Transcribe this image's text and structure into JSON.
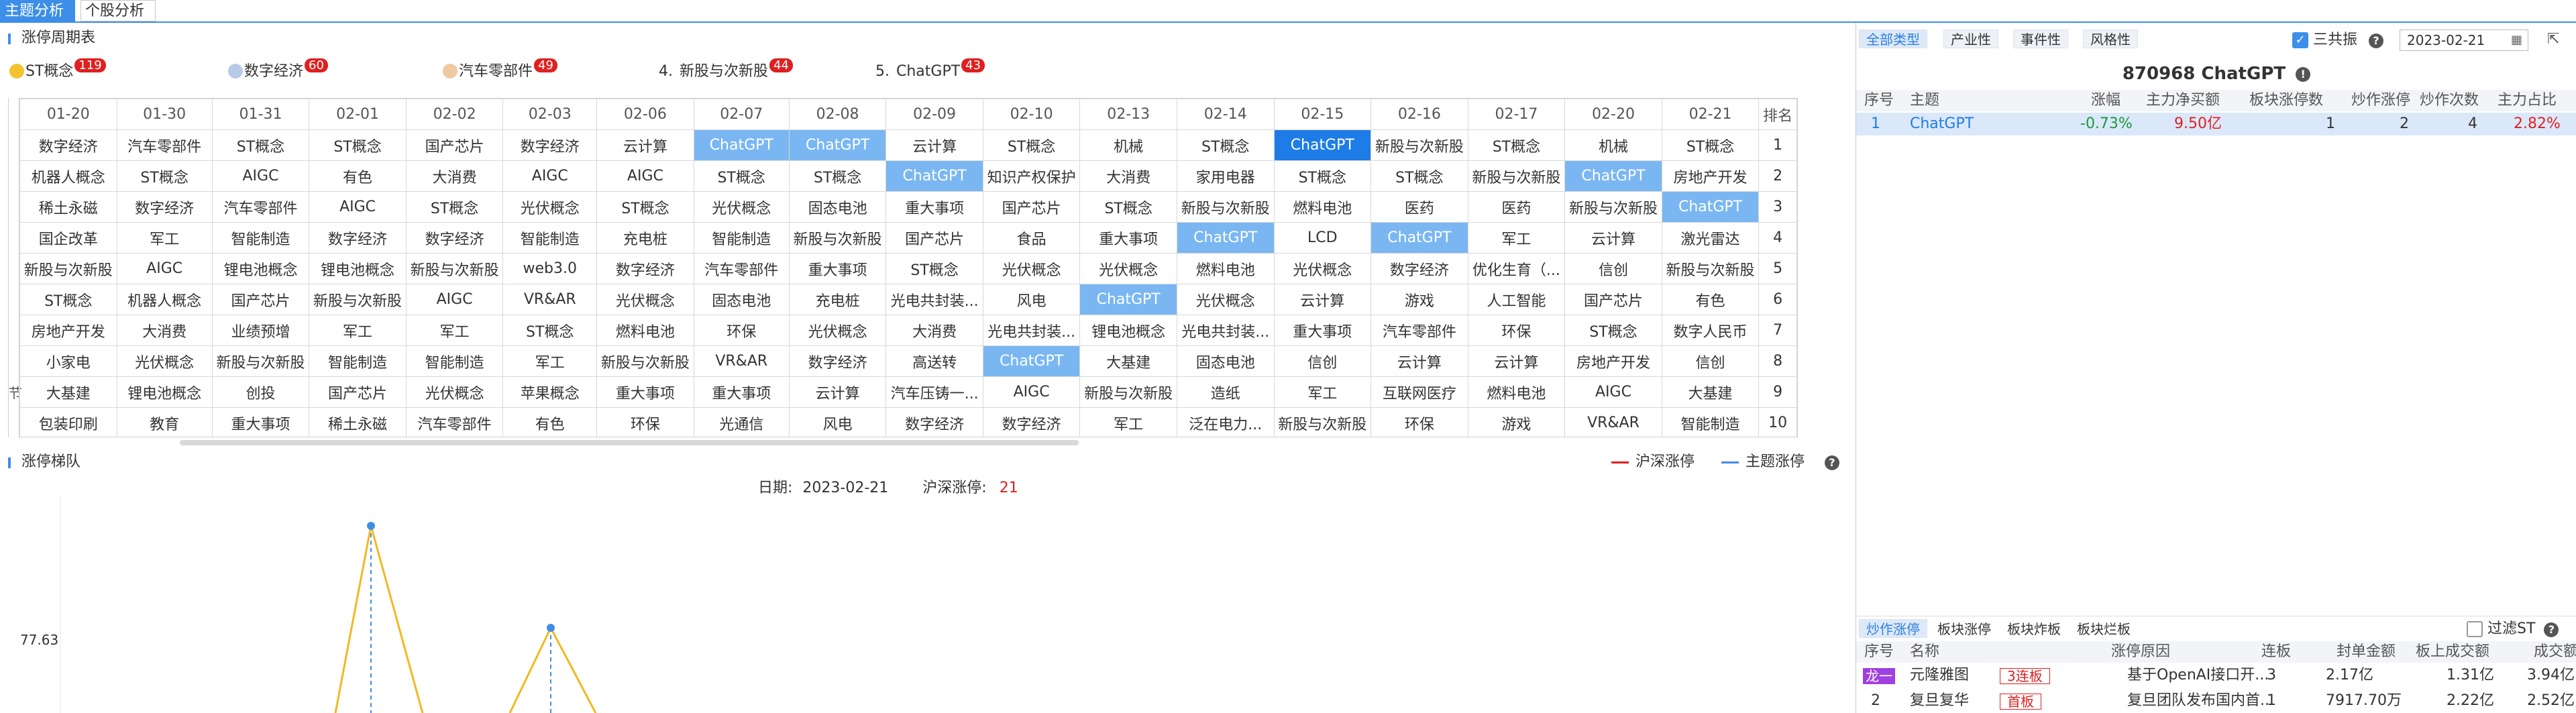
{
  "top_tabs": [
    "主题分析",
    "个股分析"
  ],
  "cycle_panel": {
    "title": "涨停周期表"
  },
  "leaders": [
    {
      "rank": "",
      "name": "ST概念",
      "count": "119",
      "dot": "#f2c230"
    },
    {
      "rank": "",
      "name": "数字经济",
      "count": "60",
      "dot": "#b9c9e8"
    },
    {
      "rank": "",
      "name": "汽车零部件",
      "count": "49",
      "dot": "#f0c8a0"
    },
    {
      "rank": "4.",
      "name": "新股与次新股",
      "count": "44",
      "dot": ""
    },
    {
      "rank": "5.",
      "name": "ChatGPT",
      "count": "43",
      "dot": ""
    }
  ],
  "cycle_table": {
    "dates": [
      "01-20",
      "01-30",
      "01-31",
      "02-01",
      "02-02",
      "02-03",
      "02-06",
      "02-07",
      "02-08",
      "02-09",
      "02-10",
      "02-13",
      "02-14",
      "02-15",
      "02-16",
      "02-17",
      "02-20",
      "02-21"
    ],
    "rank_header": "排名",
    "rows": [
      {
        "rank": "1",
        "cells": [
          "数字经济",
          "汽车零部件",
          "ST概念",
          "ST概念",
          "国产芯片",
          "数字经济",
          "云计算",
          "ChatGPT",
          "ChatGPT",
          "云计算",
          "ST概念",
          "机械",
          "ST概念",
          "ChatGPT",
          "新股与次新股",
          "ST概念",
          "机械",
          "ST概念"
        ]
      },
      {
        "rank": "2",
        "cells": [
          "机器人概念",
          "ST概念",
          "AIGC",
          "有色",
          "大消费",
          "AIGC",
          "AIGC",
          "ST概念",
          "ST概念",
          "ChatGPT",
          "知识产权保护",
          "大消费",
          "家用电器",
          "ST概念",
          "ST概念",
          "新股与次新股",
          "ChatGPT",
          "房地产开发"
        ]
      },
      {
        "rank": "3",
        "cells": [
          "稀土永磁",
          "数字经济",
          "汽车零部件",
          "AIGC",
          "ST概念",
          "光伏概念",
          "ST概念",
          "光伏概念",
          "固态电池",
          "重大事项",
          "国产芯片",
          "ST概念",
          "新股与次新股",
          "燃料电池",
          "医药",
          "医药",
          "新股与次新股",
          "ChatGPT"
        ]
      },
      {
        "rank": "4",
        "cells": [
          "国企改革",
          "军工",
          "智能制造",
          "数字经济",
          "数字经济",
          "智能制造",
          "充电桩",
          "智能制造",
          "新股与次新股",
          "国产芯片",
          "食品",
          "重大事项",
          "ChatGPT",
          "LCD",
          "ChatGPT",
          "军工",
          "云计算",
          "激光雷达"
        ]
      },
      {
        "rank": "5",
        "cells": [
          "新股与次新股",
          "AIGC",
          "锂电池概念",
          "锂电池概念",
          "新股与次新股",
          "web3.0",
          "数字经济",
          "汽车零部件",
          "重大事项",
          "ST概念",
          "光伏概念",
          "光伏概念",
          "燃料电池",
          "光伏概念",
          "数字经济",
          "优化生育（...",
          "信创",
          "新股与次新股"
        ]
      },
      {
        "rank": "6",
        "cells": [
          "ST概念",
          "机器人概念",
          "国产芯片",
          "新股与次新股",
          "AIGC",
          "VR&AR",
          "光伏概念",
          "固态电池",
          "充电桩",
          "光电共封装...",
          "风电",
          "ChatGPT",
          "光伏概念",
          "云计算",
          "游戏",
          "人工智能",
          "国产芯片",
          "有色"
        ]
      },
      {
        "rank": "7",
        "cells": [
          "房地产开发",
          "大消费",
          "业绩预增",
          "军工",
          "军工",
          "ST概念",
          "燃料电池",
          "环保",
          "光伏概念",
          "大消费",
          "光电共封装...",
          "锂电池概念",
          "光电共封装...",
          "重大事项",
          "汽车零部件",
          "环保",
          "ST概念",
          "数字人民币"
        ]
      },
      {
        "rank": "8",
        "cells": [
          "小家电",
          "光伏概念",
          "新股与次新股",
          "智能制造",
          "智能制造",
          "军工",
          "新股与次新股",
          "VR&AR",
          "数字经济",
          "高送转",
          "ChatGPT",
          "大基建",
          "固态电池",
          "信创",
          "云计算",
          "云计算",
          "房地产开发",
          "信创"
        ]
      },
      {
        "rank": "9",
        "cells": [
          "大基建",
          "锂电池概念",
          "创投",
          "国产芯片",
          "光伏概念",
          "苹果概念",
          "重大事项",
          "重大事项",
          "云计算",
          "汽车压铸一...",
          "AIGC",
          "新股与次新股",
          "造纸",
          "军工",
          "互联网医疗",
          "燃料电池",
          "AIGC",
          "大基建"
        ]
      },
      {
        "rank": "10",
        "cells": [
          "包装印刷",
          "教育",
          "重大事项",
          "稀土永磁",
          "汽车零部件",
          "有色",
          "环保",
          "光通信",
          "风电",
          "数字经济",
          "数字经济",
          "军工",
          "泛在电力...",
          "新股与次新股",
          "环保",
          "游戏",
          "VR&AR",
          "智能制造"
        ]
      }
    ],
    "highlights": [
      {
        "row": 0,
        "col": 7,
        "style": "light"
      },
      {
        "row": 0,
        "col": 8,
        "style": "light"
      },
      {
        "row": 0,
        "col": 13,
        "style": "dark"
      },
      {
        "row": 1,
        "col": 9,
        "style": "light"
      },
      {
        "row": 1,
        "col": 16,
        "style": "light"
      },
      {
        "row": 2,
        "col": 17,
        "style": "light"
      },
      {
        "row": 3,
        "col": 12,
        "style": "light"
      },
      {
        "row": 3,
        "col": 14,
        "style": "light"
      },
      {
        "row": 5,
        "col": 11,
        "style": "light"
      },
      {
        "row": 7,
        "col": 10,
        "style": "light"
      }
    ],
    "edge_chars": [
      "节"
    ]
  },
  "chart_panel": {
    "title": "涨停梯队",
    "legend_market": "沪深涨停",
    "legend_theme": "主题涨停",
    "market_color": "#e02020",
    "theme_color": "#3d8ee8",
    "date_label": "日期:",
    "date_value": "2023-02-21",
    "count_label": "沪深涨停:",
    "count_value": "21",
    "y_tick": "77.63"
  },
  "right_panel": {
    "tabs": [
      "全部类型",
      "产业性",
      "事件性",
      "风格性"
    ],
    "sanguzhen_label": "三共振",
    "date": "2023-02-21",
    "theme_title": "870968 ChatGPT",
    "theme_headers": [
      "序号",
      "主题",
      "涨幅",
      "主力净买额",
      "板块涨停数",
      "炒作涨停",
      "炒作次数",
      "主力占比"
    ],
    "theme_row": {
      "no": "1",
      "name": "ChatGPT",
      "change": "-0.73%",
      "net_buy": "9.50亿",
      "limit_up": "1",
      "hype_limit": "2",
      "hype_times": "4",
      "ratio": "2.82%"
    },
    "bottom_tabs": [
      "炒作涨停",
      "板块涨停",
      "板块炸板",
      "板块烂板"
    ],
    "filter_st": "过滤ST",
    "stock_headers": [
      "序号",
      "名称",
      "涨停原因",
      "连板",
      "封单金额",
      "板上成交额",
      "成交额"
    ],
    "stocks": [
      {
        "no": "龙一",
        "name": "元隆雅图",
        "tag": "3连板",
        "reason": "基于OpenAI接口开...",
        "boards": "3",
        "seal": "2.17亿",
        "on_board": "1.31亿",
        "turnover": "3.94亿"
      },
      {
        "no": "2",
        "name": "复旦复华",
        "tag": "首板",
        "reason": "复旦团队发布国内首...",
        "boards": "1",
        "seal": "7917.70万",
        "on_board": "2.22亿",
        "turnover": "2.52亿"
      }
    ]
  }
}
